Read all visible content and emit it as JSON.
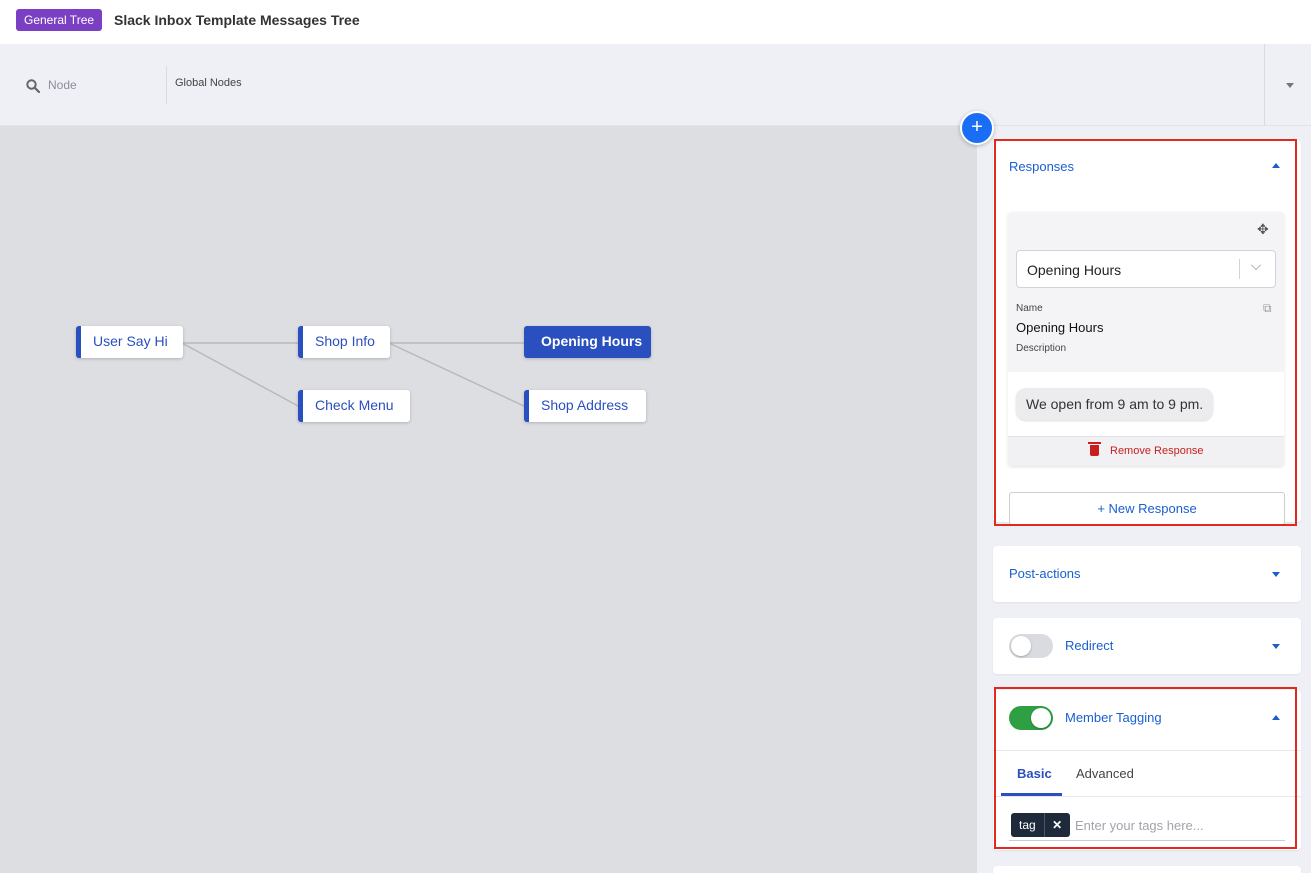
{
  "header": {
    "badge": "General Tree",
    "title": "Slack Inbox Template Messages Tree"
  },
  "search": {
    "placeholder": "Node",
    "scope": "Global Nodes"
  },
  "canvas": {
    "nodes": [
      {
        "label": "User Say Hi",
        "active": false
      },
      {
        "label": "Shop Info",
        "active": false
      },
      {
        "label": "Check Menu",
        "active": false
      },
      {
        "label": "Opening Hours",
        "active": true
      },
      {
        "label": "Shop Address",
        "active": false
      }
    ],
    "add_button": "+"
  },
  "panel": {
    "responses": {
      "title": "Responses",
      "selected_response": "Opening Hours",
      "name_label": "Name",
      "name_value": "Opening Hours",
      "description_label": "Description",
      "message": "We open from 9 am to 9 pm.",
      "remove_label": "Remove Response",
      "new_label": "+ New Response"
    },
    "post_actions": {
      "title": "Post-actions"
    },
    "redirect": {
      "title": "Redirect",
      "enabled": false
    },
    "member_tagging": {
      "title": "Member Tagging",
      "enabled": true,
      "tabs": [
        "Basic",
        "Advanced"
      ],
      "active_tab": "Basic",
      "tag": "tag",
      "tag_remove": "✕",
      "input_placeholder": "Enter your tags here..."
    }
  },
  "colors": {
    "accent": "#2a4fbf",
    "badge": "#7b3fc4",
    "highlight": "#e02a1e",
    "toggle_on": "#2ea043",
    "danger": "#c81e1e"
  }
}
